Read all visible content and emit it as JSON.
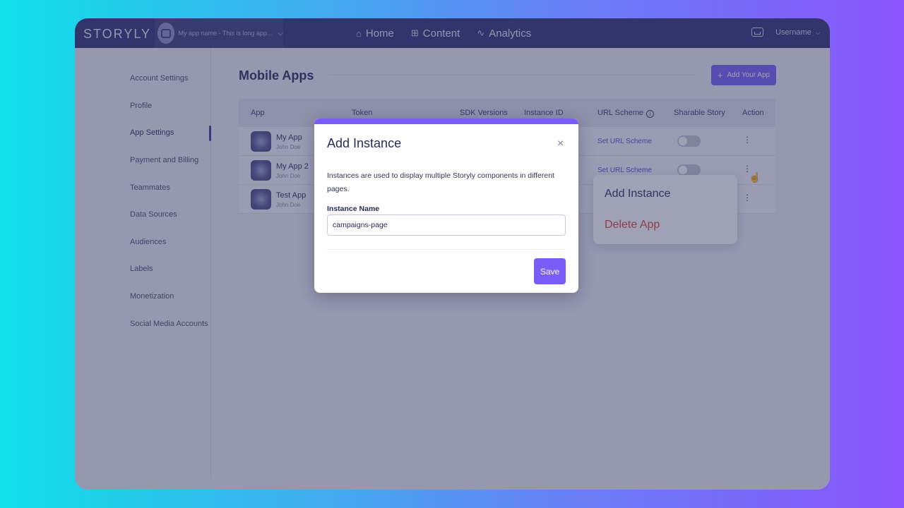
{
  "topbar": {
    "logo": "STORYLY",
    "app_name": "My app name - This is long app...",
    "nav": [
      {
        "icon": "home-icon",
        "glyph": "⌂",
        "label": "Home"
      },
      {
        "icon": "grid-icon",
        "glyph": "⊞",
        "label": "Content"
      },
      {
        "icon": "pulse-icon",
        "glyph": "∿",
        "label": "Analytics"
      }
    ],
    "username": "Username"
  },
  "sidebar": {
    "items": [
      {
        "label": "Account Settings"
      },
      {
        "label": "Profile"
      },
      {
        "label": "App Settings",
        "active": true
      },
      {
        "label": "Payment and Billing"
      },
      {
        "label": "Teammates"
      },
      {
        "label": "Data Sources"
      },
      {
        "label": "Audiences"
      },
      {
        "label": "Labels"
      },
      {
        "label": "Monetization"
      },
      {
        "label": "Social Media Accounts"
      }
    ]
  },
  "main": {
    "title": "Mobile Apps",
    "add_button": "Add Your App",
    "table": {
      "headers": [
        "App",
        "Token",
        "SDK Versions",
        "Instance ID",
        "URL Scheme",
        "Sharable Story",
        "Action"
      ],
      "rows": [
        {
          "name": "My App",
          "owner": "John Doe",
          "url_scheme": "Set URL Scheme"
        },
        {
          "name": "My App 2",
          "owner": "John Doe",
          "url_scheme": "Set URL Scheme"
        },
        {
          "name": "Test App",
          "owner": "John Doe",
          "url_scheme": ""
        }
      ]
    }
  },
  "menu": {
    "add_instance": "Add Instance",
    "delete_app": "Delete App"
  },
  "modal": {
    "title": "Add Instance",
    "description": "Instances are used to display multiple Storyly components in different pages.",
    "field_label": "Instance Name",
    "field_value": "campaigns-page",
    "save": "Save"
  },
  "colors": {
    "accent": "#7a5cf8",
    "topbar": "#2f3073",
    "danger": "#e0443c"
  }
}
